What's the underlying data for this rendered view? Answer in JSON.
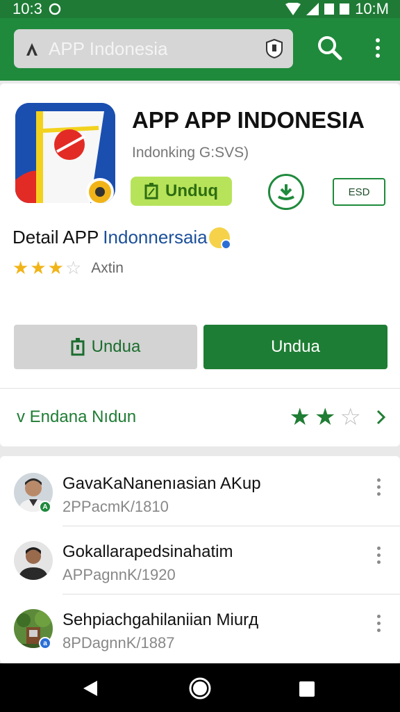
{
  "status": {
    "time": "10:3",
    "clock": "10:M"
  },
  "search": {
    "placeholder": "APP Indonesia"
  },
  "app": {
    "title": "APP APP INDONESIA",
    "subtitle": "Indonking G:SVS)",
    "primary_label": "Unduq",
    "secondary_label": "ESD"
  },
  "detail": {
    "prefix": "Detail APP",
    "name": "Indonnersaia",
    "rating": 3,
    "rating_max": 5,
    "rating_label": "Axtin"
  },
  "actions": {
    "install_label": "Undua",
    "open_label": "Undua"
  },
  "summary": {
    "label": "v Endana Nıdun",
    "rating": 2,
    "rating_max": 3
  },
  "list": [
    {
      "title": "GavaKaNanenıasian AKup",
      "subtitle": "2PPacmK/1810",
      "badge": "A"
    },
    {
      "title": "Gokallarapedsinahatim",
      "subtitle": "APPagnnK/1920",
      "badge": ""
    },
    {
      "title": "Sehpiachgahilaniian Miurд",
      "subtitle": "8PDagnnK/1887",
      "badge": "a"
    }
  ],
  "colors": {
    "primary": "#1f8a3c",
    "accent": "#b7e35a",
    "star": "#f1b418"
  }
}
